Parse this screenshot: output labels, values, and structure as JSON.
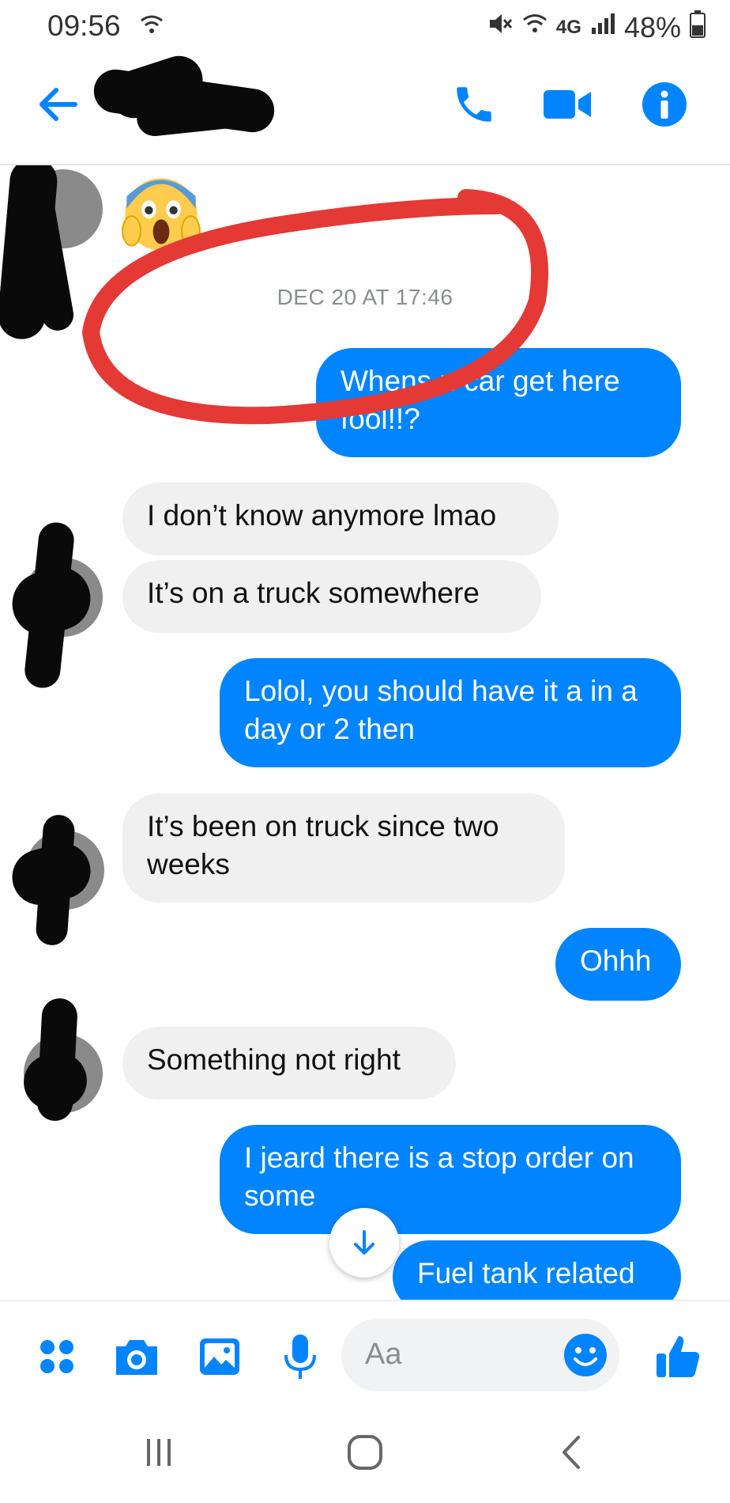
{
  "status_bar": {
    "time": "09:56",
    "network": "4G",
    "battery": "48%"
  },
  "header": {
    "back_icon": "arrow-left-icon",
    "actions": [
      "phone-icon",
      "video-camera-icon",
      "info-icon"
    ]
  },
  "conversation": {
    "timestamp": "DEC 20 AT 17:46",
    "messages": [
      {
        "direction": "out",
        "text": "Whens u car get here fool!!?"
      },
      {
        "direction": "in",
        "text": "I don’t know anymore lmao"
      },
      {
        "direction": "in",
        "text": "It’s on a truck somewhere"
      },
      {
        "direction": "out",
        "text": "Lolol, you should have it a in a day or 2 then"
      },
      {
        "direction": "in",
        "text": "It’s been on truck since two weeks"
      },
      {
        "direction": "out",
        "text": "Ohhh"
      },
      {
        "direction": "in",
        "text": "Something not right"
      },
      {
        "direction": "out",
        "text": "I jeard there is a stop order on some"
      },
      {
        "direction": "out",
        "text": "Fuel tank related"
      }
    ]
  },
  "composer": {
    "placeholder": "Aa",
    "icons": [
      "menu-dots-icon",
      "camera-icon",
      "gallery-icon",
      "microphone-icon",
      "emoji-icon",
      "thumbs-up-icon"
    ]
  },
  "colors": {
    "accent": "#0084ff",
    "incoming_bubble": "#f0f0f0",
    "annotation_red": "#e53935"
  }
}
